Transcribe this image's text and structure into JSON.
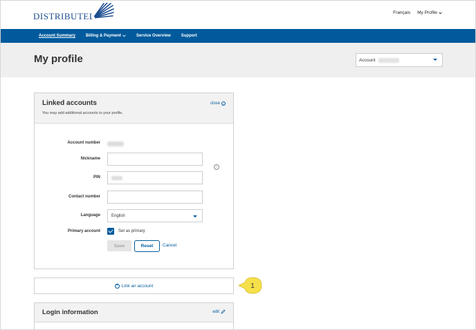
{
  "header": {
    "logo_text": "DISTRIBUTEL",
    "lang_link": "Français",
    "profile_link": "My Profile"
  },
  "nav": {
    "items": [
      {
        "label": "Account Summary"
      },
      {
        "label": "Billing & Payment"
      },
      {
        "label": "Service Overview"
      },
      {
        "label": "Support"
      }
    ]
  },
  "page": {
    "title": "My profile",
    "account_select_label": "Account"
  },
  "linked_accounts": {
    "title": "Linked accounts",
    "subtitle": "You may add additional accounts to your profile.",
    "close_label": "close",
    "fields": {
      "account_number_label": "Account number",
      "nickname_label": "Nickname",
      "pin_label": "PIN",
      "contact_label": "Contact number",
      "language_label": "Language",
      "language_value": "English",
      "primary_label": "Primary account",
      "primary_checkbox_label": "Set as primary"
    },
    "buttons": {
      "save": "Save",
      "reset": "Reset",
      "cancel": "Cancel"
    }
  },
  "link_account": {
    "label": "Link an account"
  },
  "callout": {
    "number": "1",
    "color": "#f6e04a"
  },
  "login_info": {
    "title": "Login information",
    "edit_label": "edit"
  },
  "colors": {
    "brand_blue": "#005a9c"
  }
}
